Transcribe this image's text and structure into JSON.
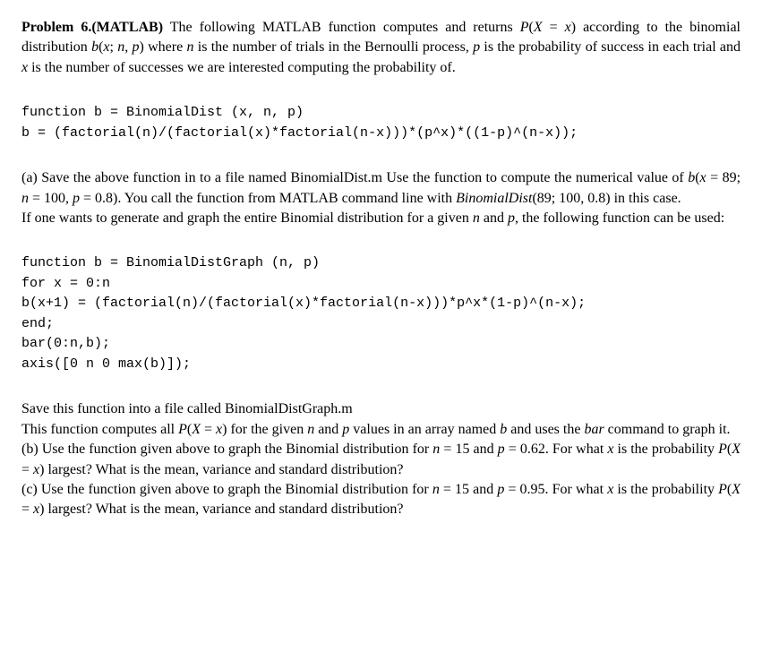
{
  "problem": {
    "title_bold": "Problem 6.(MATLAB)",
    "intro": " The following MATLAB function computes and returns P(X = x) according to the binomial distribution b(x; n, p) where n is the number of trials in the Bernoulli process, p is the probability of success in each trial and x is the number of successes we are interested computing the probability of."
  },
  "code1": {
    "line1": "function b = BinomialDist (x, n, p)",
    "line2": "b = (factorial(n)/(factorial(x)*factorial(n-x)))*(p^x)*((1-p)^(n-x));"
  },
  "part_a": {
    "text1": "(a) Save the above function in to a file named BinomialDist.m Use the function to compute the numerical value of b(x = 89; n = 100, p = 0.8). You call the function from MATLAB command line with ",
    "text_italic": "BinomialDist",
    "text2": "(89; 100, 0.8) in this case.",
    "text3": "If one wants to generate and graph the entire Binomial distribution for a given n and p, the following function can be used:"
  },
  "code2": {
    "line1": "function b = BinomialDistGraph (n, p)",
    "line2": "for x = 0:n",
    "line3": "b(x+1) = (factorial(n)/(factorial(x)*factorial(n-x)))*p^x*(1-p)^(n-x);",
    "line4": "end;",
    "line5": "bar(0:n,b);",
    "line6": "axis([0 n 0 max(b)]);"
  },
  "part_save": {
    "text1": "Save this function into a file called BinomialDistGraph.m",
    "text2_a": "This function computes all P(X = x) for the given n and p values in an array named ",
    "text2_b_italic": "b",
    "text2_c": " and uses the ",
    "text2_d_italic": "bar",
    "text2_e": " command to graph it."
  },
  "part_b": {
    "text": "(b) Use the function given above to graph the Binomial distribution for n = 15 and p = 0.62. For what x is the probability P(X = x) largest? What is the mean, variance and standard distribution?"
  },
  "part_c": {
    "text": "(c) Use the function given above to graph the Binomial distribution for n = 15 and p = 0.95. For what x is the probability P(X = x) largest? What is the mean, variance and standard distribution?"
  }
}
